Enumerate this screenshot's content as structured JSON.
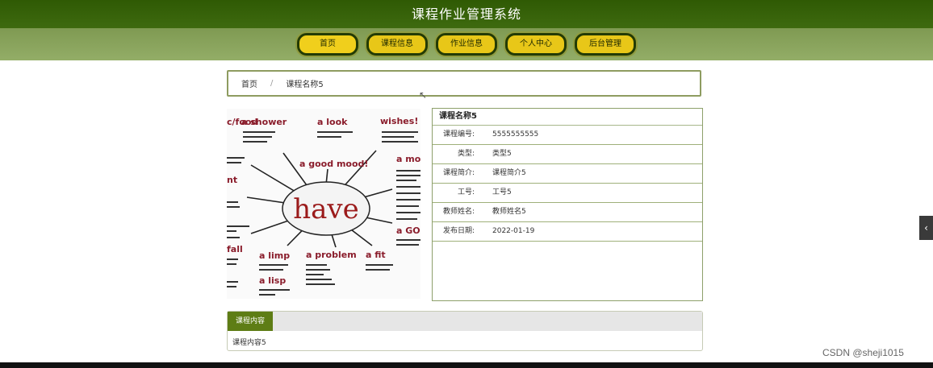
{
  "header": {
    "title": "课程作业管理系统"
  },
  "nav": {
    "items": [
      {
        "label": "首页"
      },
      {
        "label": "课程信息"
      },
      {
        "label": "作业信息"
      },
      {
        "label": "个人中心"
      },
      {
        "label": "后台管理"
      }
    ]
  },
  "breadcrumb": {
    "home": "首页",
    "separator": "/",
    "current": "课程名称5"
  },
  "image": {
    "center_word": "have",
    "phrases": [
      "a shower",
      "a look",
      "wishes!",
      "a good mood!",
      "a mom",
      "a GO!",
      "a fit",
      "a problem",
      "a limp",
      "a lisp",
      "fall",
      "nt",
      "c/food"
    ]
  },
  "detail": {
    "title": "课程名称5",
    "rows": [
      {
        "label": "课程编号:",
        "value": "5555555555"
      },
      {
        "label": "类型:",
        "value": "类型5"
      },
      {
        "label": "课程简介:",
        "value": "课程简介5"
      },
      {
        "label": "工号:",
        "value": "工号5"
      },
      {
        "label": "教师姓名:",
        "value": "教师姓名5"
      },
      {
        "label": "发布日期:",
        "value": "2022-01-19"
      }
    ]
  },
  "tabs": {
    "active_label": "课程内容",
    "content": "课程内容5"
  },
  "side_toggle": {
    "glyph": "‹"
  },
  "watermark": "CSDN @sheji1015",
  "colors": {
    "header": "#3a6509",
    "nav": "#8aa45e",
    "button": "#e8c718",
    "tab_active": "#5e7d15"
  }
}
